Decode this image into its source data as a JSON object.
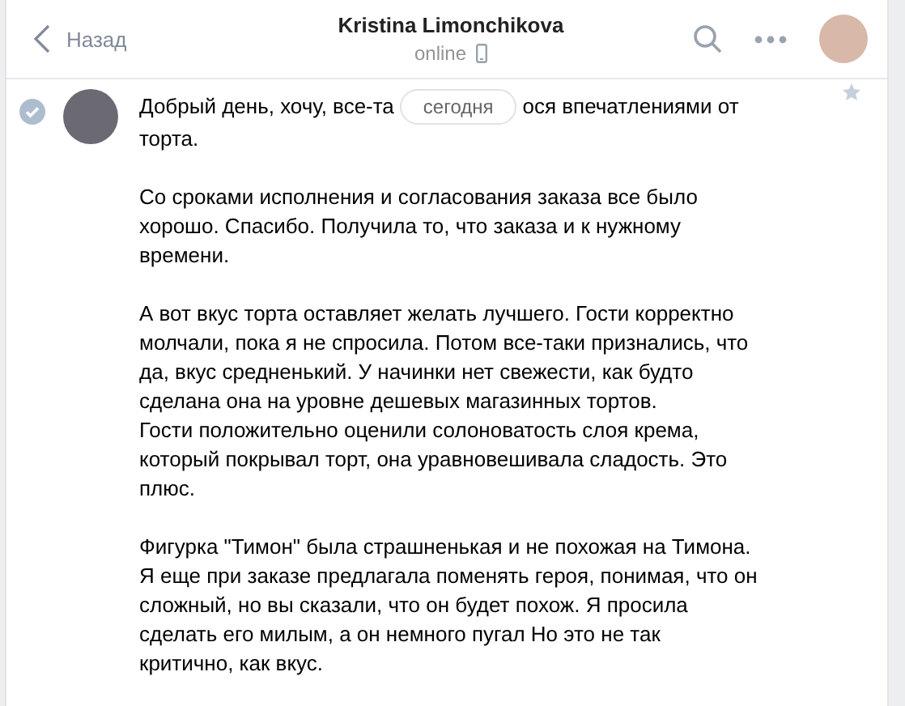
{
  "header": {
    "back": "Назад",
    "title": "Kristina Limonchikova",
    "status": "online"
  },
  "date_divider": "сегодня",
  "message": {
    "selected": true,
    "first_line": [
      "Добрый день, хочу, все-та",
      "ося впечатлениями от"
    ],
    "paragraphs": [
      [
        "торта."
      ],
      [
        "Со сроками исполнения и согласования заказа все было",
        "хорошо. Спасибо. Получила то, что заказа и к нужному",
        "времени."
      ],
      [
        "А вот вкус торта оставляет желать лучшего. Гости корректно",
        "молчали, пока я не спросила. Потом все-таки признались, что",
        "да, вкус средненький. У начинки нет свежести, как будто",
        "сделана она на уровне дешевых магазинных тортов.",
        "Гости положительно оценили солоноватость слоя крема,",
        "который покрывал торт, она уравновешивала сладость. Это",
        "плюс."
      ],
      [
        "Фигурка \"Тимон\" была страшненькая и не похожая на Тимона.",
        "Я еще при заказе предлагала поменять героя, понимая, что он",
        "сложный, но вы сказали, что он будет похож. Я просила",
        "сделать его милым, а он немного пугал Но это не так",
        "критично, как вкус."
      ]
    ]
  }
}
